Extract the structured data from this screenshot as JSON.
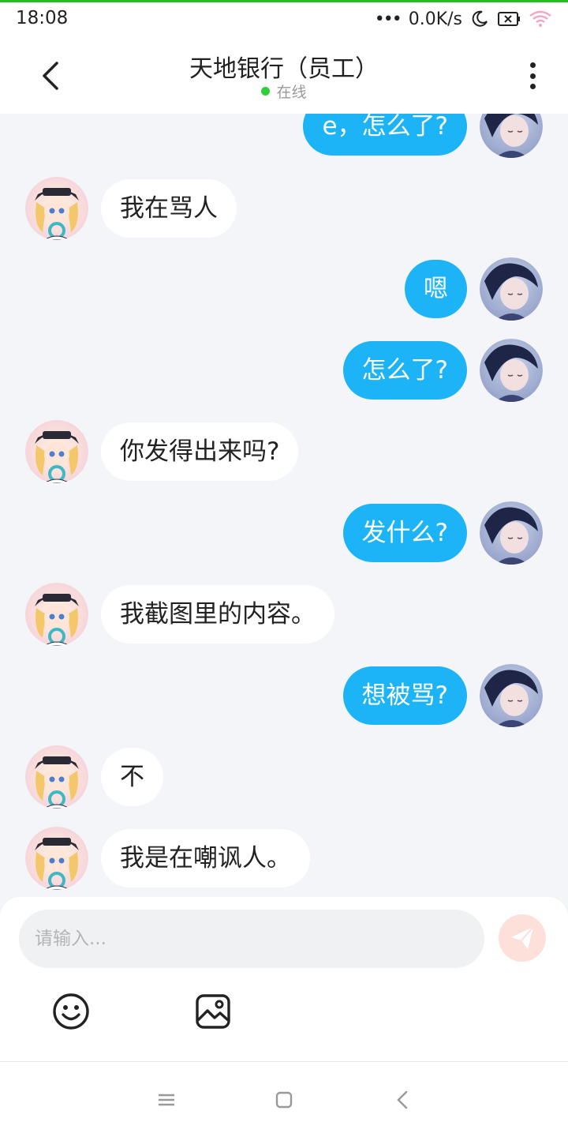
{
  "status_bar": {
    "time": "18:08",
    "net_speed": "0.0K/s",
    "icons": [
      "signal-dots-icon",
      "moon-icon",
      "battery-x-icon",
      "wifi-icon"
    ]
  },
  "header": {
    "title": "天地银行（员工）",
    "status": "在线",
    "status_color": "#2fcf3a",
    "icons": [
      "back-arrow-icon",
      "more-vertical-icon"
    ]
  },
  "colors": {
    "my_bubble": "#1cb4f6",
    "other_bubble": "#ffffff",
    "background": "#f3f5f8"
  },
  "messages": [
    {
      "sender": "me",
      "text": "e，怎么了?"
    },
    {
      "sender": "other",
      "text": "我在骂人"
    },
    {
      "sender": "me",
      "text": "嗯"
    },
    {
      "sender": "me",
      "text": "怎么了?"
    },
    {
      "sender": "other",
      "text": "你发得出来吗?"
    },
    {
      "sender": "me",
      "text": "发什么?"
    },
    {
      "sender": "other",
      "text": "我截图里的内容。"
    },
    {
      "sender": "me",
      "text": "想被骂?"
    },
    {
      "sender": "other",
      "text": "不"
    },
    {
      "sender": "other",
      "text": "我是在嘲讽人。"
    }
  ],
  "composer": {
    "placeholder": "请输入...",
    "value": "",
    "icons": [
      "send-icon",
      "emoji-icon",
      "image-icon"
    ]
  },
  "nav_bar": {
    "icons": [
      "menu-icon",
      "home-icon",
      "back-icon"
    ]
  }
}
